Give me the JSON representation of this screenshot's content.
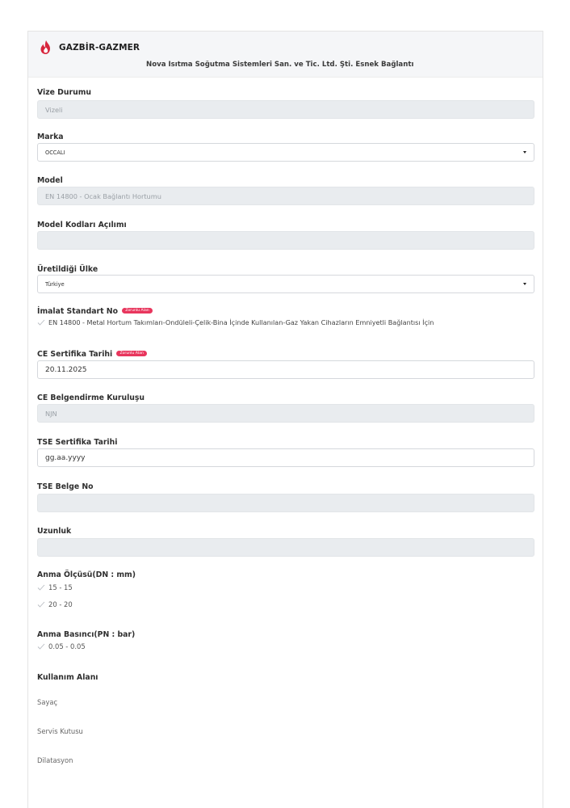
{
  "header": {
    "brand": "GAZBİR-GAZMER",
    "company": "Nova Isıtma Soğutma Sistemleri San. ve Tic. Ltd. Şti. Esnek Bağlantı"
  },
  "required_badge": "Zorunlu Alan",
  "fields": {
    "vize": {
      "label": "Vize Durumu",
      "value": "Vizeli"
    },
    "marka": {
      "label": "Marka",
      "value": "OCCALI"
    },
    "model": {
      "label": "Model",
      "value": "EN 14800 - Ocak Bağlantı Hortumu"
    },
    "model_kodlari": {
      "label": "Model Kodları Açılımı",
      "value": ""
    },
    "ulke": {
      "label": "Üretildiği Ülke",
      "value": "Türkiye"
    },
    "imalat": {
      "label": "İmalat Standart No",
      "value": "EN 14800 - Metal Hortum Takımları-Ondüleli-Çelik-Bina İçinde Kullanılan-Gaz Yakan Cihazların Emniyetli Bağlantısı İçin"
    },
    "ce_tarih": {
      "label": "CE Sertifika Tarihi",
      "value": "20.11.2025"
    },
    "ce_kurulus": {
      "label": "CE Belgendirme Kuruluşu",
      "value": "NJN"
    },
    "tse_tarih": {
      "label": "TSE Sertifika Tarihi",
      "placeholder": "gg.aa.yyyy"
    },
    "tse_no": {
      "label": "TSE Belge No",
      "value": ""
    },
    "uzunluk": {
      "label": "Uzunluk",
      "value": ""
    },
    "anma_olcusu": {
      "label": "Anma Ölçüsü(DN : mm)",
      "options": [
        "15 - 15",
        "20 - 20"
      ]
    },
    "anma_basinci": {
      "label": "Anma Basıncı(PN : bar)",
      "options": [
        "0.05 - 0.05"
      ]
    },
    "kullanim": {
      "label": "Kullanım Alanı",
      "items": [
        "Sayaç",
        "Servis Kutusu",
        "Dilatasyon"
      ]
    }
  }
}
